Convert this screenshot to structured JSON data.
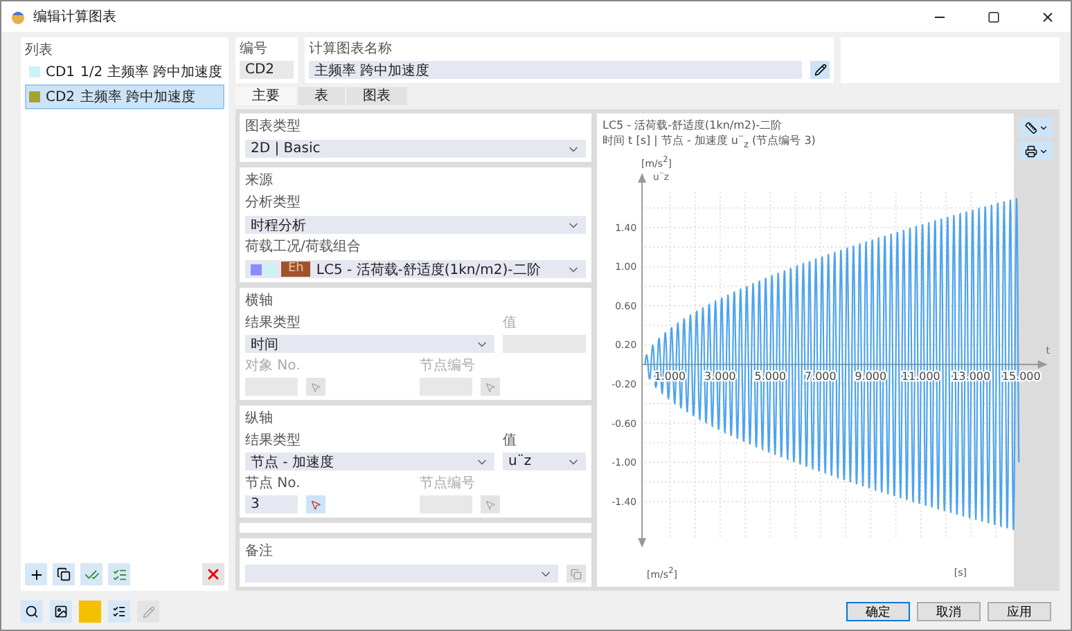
{
  "window": {
    "title": "编辑计算图表"
  },
  "list": {
    "title": "列表",
    "items": [
      {
        "code": "CD1",
        "name": "1/2 主频率 跨中加速度",
        "color": "#c8f4f6",
        "selected": false
      },
      {
        "code": "CD2",
        "name": "主频率 跨中加速度",
        "color": "#a3a33a",
        "selected": true
      }
    ]
  },
  "header": {
    "number_label": "编号",
    "number": "CD2",
    "name_label": "计算图表名称",
    "name": "主频率 跨中加速度"
  },
  "tabs": [
    {
      "label": "主要",
      "selected": true
    },
    {
      "label": "表",
      "selected": false
    },
    {
      "label": "图表",
      "selected": false
    }
  ],
  "chart_type": {
    "label": "图表类型",
    "value": "2D | Basic"
  },
  "source": {
    "title": "来源",
    "analysis_label": "分析类型",
    "analysis": "时程分析",
    "load_label": "荷载工况/荷载组合",
    "load_tag": "Eh",
    "load": "LC5 - 活荷载-舒适度(1kn/m2)-二阶"
  },
  "x_axis": {
    "title": "横轴",
    "result_label": "结果类型",
    "result": "时间",
    "value_label": "值",
    "object_label": "对象 No.",
    "node_label": "节点编号"
  },
  "y_axis": {
    "title": "纵轴",
    "result_label": "结果类型",
    "result": "节点 - 加速度",
    "value_label": "值",
    "value": "u¨z",
    "node_no_label": "节点 No.",
    "node_no": "3",
    "node_label": "节点编号"
  },
  "note": {
    "label": "备注"
  },
  "chart": {
    "line1": "LC5 - 活荷载-舒适度(1kn/m2)-二阶",
    "line2": "时间 t [s] | 节点 - 加速度 u¨$_{z}$ (节点编号 3)",
    "y_label": "u¨z",
    "y_unit": "[m/s$^{2}$]",
    "x_label": "t",
    "x_unit": "[s]",
    "bottom_unit": "[m/s$^{2}$]",
    "yticks": [
      "1.40",
      "1.00",
      "0.60",
      "0.20",
      "-0.20",
      "-0.60",
      "-1.00",
      "-1.40"
    ],
    "xticks": [
      "1.000",
      "3.000",
      "5.000",
      "7.000",
      "9.000",
      "11.000",
      "13.000",
      "15.000"
    ]
  },
  "buttons": [
    {
      "label": "确定",
      "kind": "default"
    },
    {
      "label": "取消",
      "kind": "normal"
    },
    {
      "label": "应用",
      "kind": "normal"
    }
  ]
}
